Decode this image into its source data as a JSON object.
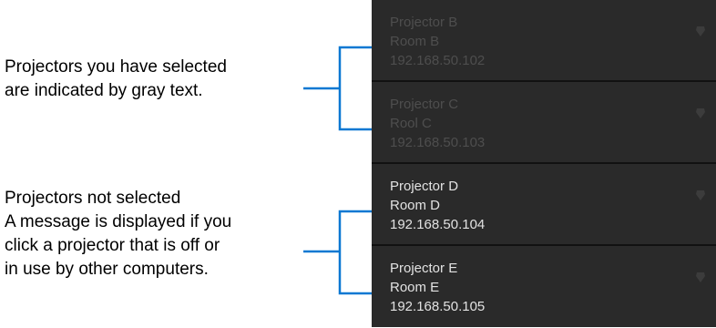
{
  "annotations": {
    "selected": [
      "Projectors you have selected",
      "are indicated by gray text."
    ],
    "unselected": [
      "Projectors not selected",
      "A message is displayed if you",
      "click a projector that is off or",
      "in use by other computers."
    ]
  },
  "projectors": [
    {
      "name": "Projector B",
      "room": "Room B",
      "ip": "192.168.50.102",
      "state": "selected"
    },
    {
      "name": "Projector C",
      "room": "Rool C",
      "ip": "192.168.50.103",
      "state": "selected"
    },
    {
      "name": "Projector D",
      "room": "Room D",
      "ip": "192.168.50.104",
      "state": "not-selected"
    },
    {
      "name": "Projector E",
      "room": "Room E",
      "ip": "192.168.50.105",
      "state": "not-selected"
    }
  ],
  "icons": {
    "status": "status-shield-icon"
  },
  "colors": {
    "panel_background": "#2a2a2a",
    "divider": "#111111",
    "selected_text": "#4e4e4e",
    "unselected_text": "#e2e2e2",
    "callout_line": "#0a78d2"
  }
}
